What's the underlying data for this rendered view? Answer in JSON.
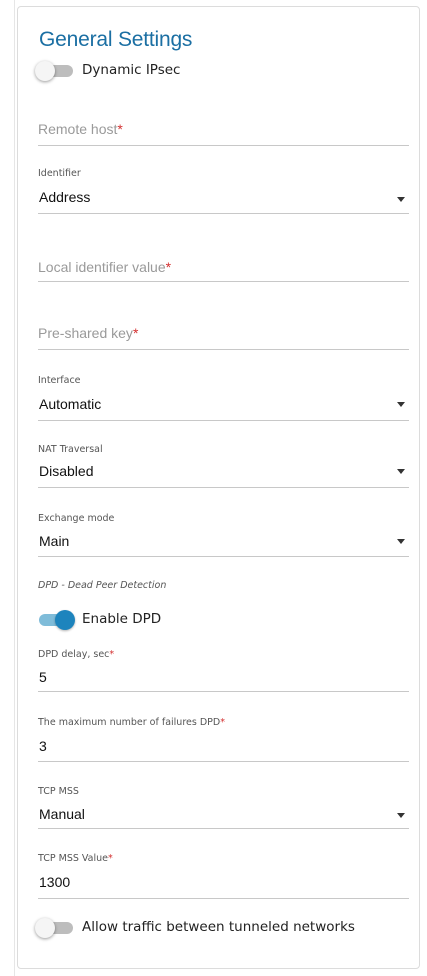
{
  "section": {
    "title": "General Settings"
  },
  "dynamic_ipsec": {
    "label": "Dynamic IPsec",
    "enabled": false
  },
  "remote_host": {
    "placeholder": "Remote host",
    "required_mark": "*"
  },
  "identifier": {
    "label": "Identifier",
    "value": "Address"
  },
  "local_identifier": {
    "placeholder": "Local identifier value",
    "required_mark": "*"
  },
  "pre_shared_key": {
    "placeholder": "Pre-shared key",
    "required_mark": "*"
  },
  "interface": {
    "label": "Interface",
    "value": "Automatic"
  },
  "nat_traversal": {
    "label": "NAT Traversal",
    "value": "Disabled"
  },
  "exchange_mode": {
    "label": "Exchange mode",
    "value": "Main"
  },
  "dpd": {
    "section_label": "DPD - Dead Peer Detection",
    "enable_label": "Enable DPD",
    "enabled": true,
    "delay_label": "DPD delay, sec",
    "delay_required": "*",
    "delay_value": "5",
    "max_failures_label": "The maximum number of failures DPD",
    "max_failures_required": "*",
    "max_failures_value": "3"
  },
  "tcp_mss": {
    "label": "TCP MSS",
    "value": "Manual"
  },
  "tcp_mss_value": {
    "label": "TCP MSS Value",
    "required_mark": "*",
    "value": "1300"
  },
  "allow_traffic": {
    "label": "Allow traffic between tunneled networks",
    "enabled": false
  },
  "colors": {
    "accent": "#1d84bd",
    "title": "#1b6fa3",
    "required": "#d32f2f"
  }
}
